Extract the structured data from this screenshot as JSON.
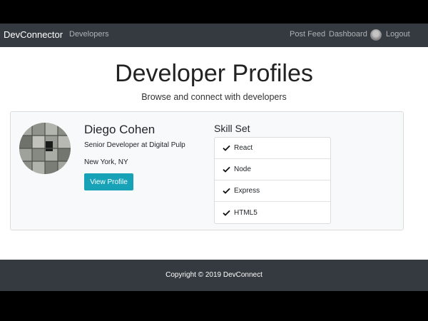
{
  "nav": {
    "brand": "DevConnector",
    "developers": "Developers",
    "post_feed": "Post Feed",
    "dashboard": "Dashboard",
    "logout": "Logout"
  },
  "page": {
    "title": "Developer Profiles",
    "subtitle": "Browse and connect with developers"
  },
  "profile": {
    "name": "Diego Cohen",
    "role": "Senior Developer at Digital Pulp",
    "location": "New York, NY",
    "view_button": "View Profile",
    "skill_title": "Skill Set",
    "skills": [
      "React",
      "Node",
      "Express",
      "HTML5"
    ]
  },
  "footer": {
    "copyright": "Copyright © 2019 DevConnect"
  },
  "colors": {
    "navbar": "#343a40",
    "accent": "#17a2b8"
  }
}
